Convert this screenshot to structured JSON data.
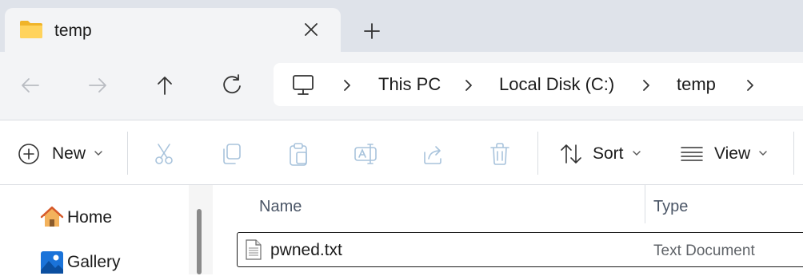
{
  "tab": {
    "title": "temp"
  },
  "breadcrumbs": [
    "This PC",
    "Local Disk (C:)",
    "temp"
  ],
  "toolbar": {
    "new_label": "New",
    "sort_label": "Sort",
    "view_label": "View"
  },
  "sidebar": {
    "items": [
      {
        "label": "Home",
        "icon": "home-icon"
      },
      {
        "label": "Gallery",
        "icon": "gallery-icon"
      }
    ]
  },
  "columns": {
    "name": "Name",
    "type": "Type"
  },
  "files": [
    {
      "name": "pwned.txt",
      "type": "Text Document",
      "icon": "text-file-icon"
    }
  ],
  "colors": {
    "folder": "#f7c948",
    "accent": "#0067c0",
    "disabled_icon": "#a8c3dc"
  }
}
